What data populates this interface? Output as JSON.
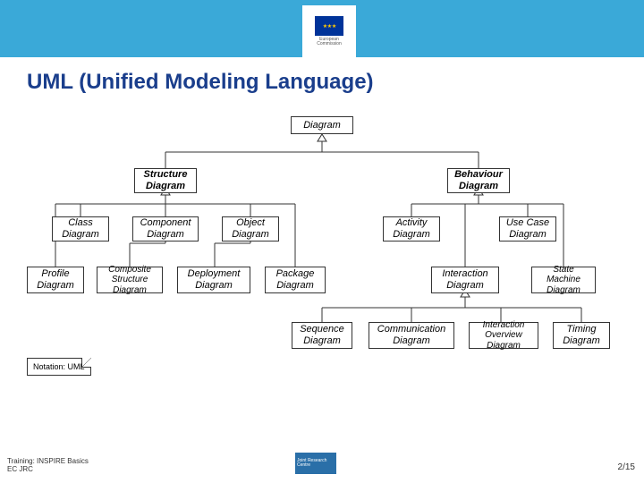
{
  "header": {
    "logo_line1": "European",
    "logo_line2": "Commission"
  },
  "title": "UML (Unified Modeling Language)",
  "diagram": {
    "root": "Diagram",
    "level1": {
      "structure": "Structure Diagram",
      "behaviour": "Behaviour Diagram"
    },
    "structure_children_row1": {
      "class": "Class Diagram",
      "component": "Component Diagram",
      "object": "Object Diagram"
    },
    "structure_children_row2": {
      "profile": "Profile Diagram",
      "composite": "Composite Structure Diagram",
      "deployment": "Deployment Diagram",
      "package": "Package Diagram"
    },
    "behaviour_children_row1": {
      "activity": "Activity Diagram",
      "usecase": "Use Case Diagram"
    },
    "behaviour_children_row2": {
      "interaction": "Interaction Diagram",
      "state": "State Machine Diagram"
    },
    "interaction_children": {
      "sequence": "Sequence Diagram",
      "communication": "Communication Diagram",
      "interaction_overview": "Interaction Overview Diagram",
      "timing": "Timing Diagram"
    }
  },
  "notation_note": "Notation: UML",
  "footer": {
    "training_line1": "Training: INSPIRE Basics",
    "training_line2": "EC JRC",
    "center": "Joint Research Centre",
    "page": "2/15"
  }
}
